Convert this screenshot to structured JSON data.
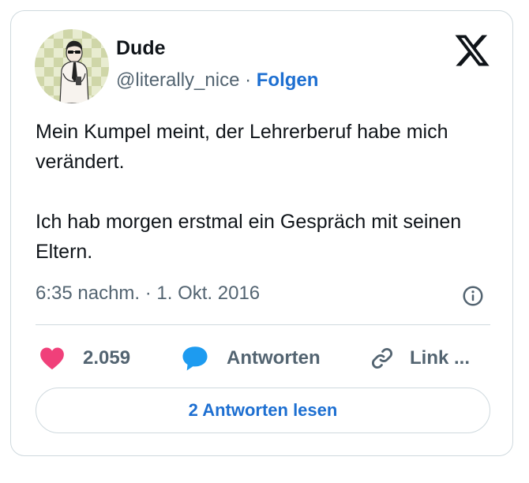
{
  "author": {
    "name": "Dude",
    "handle": "@literally_nice",
    "separator": "·",
    "follow_label": "Folgen"
  },
  "icons": {
    "logo": "x-logo-icon",
    "info": "info-icon",
    "like": "heart-icon",
    "reply": "speech-bubble-icon",
    "link": "link-icon"
  },
  "tweet": {
    "paragraphs": [
      "Mein Kumpel meint, der Lehrerberuf habe mich verändert.",
      "Ich hab morgen erstmal ein Gespräch mit seinen Eltern."
    ],
    "timestamp": "6:35 nachm. · 1. Okt. 2016"
  },
  "actions": {
    "likes": "2.059",
    "reply_label": "Antworten",
    "link_label": "Link ..."
  },
  "read_replies_label": "2 Antworten lesen",
  "colors": {
    "accent": "#1d6fd1",
    "like": "#f0407a",
    "reply": "#1d9bf0",
    "muted": "#536471",
    "border": "#cfd9de"
  }
}
